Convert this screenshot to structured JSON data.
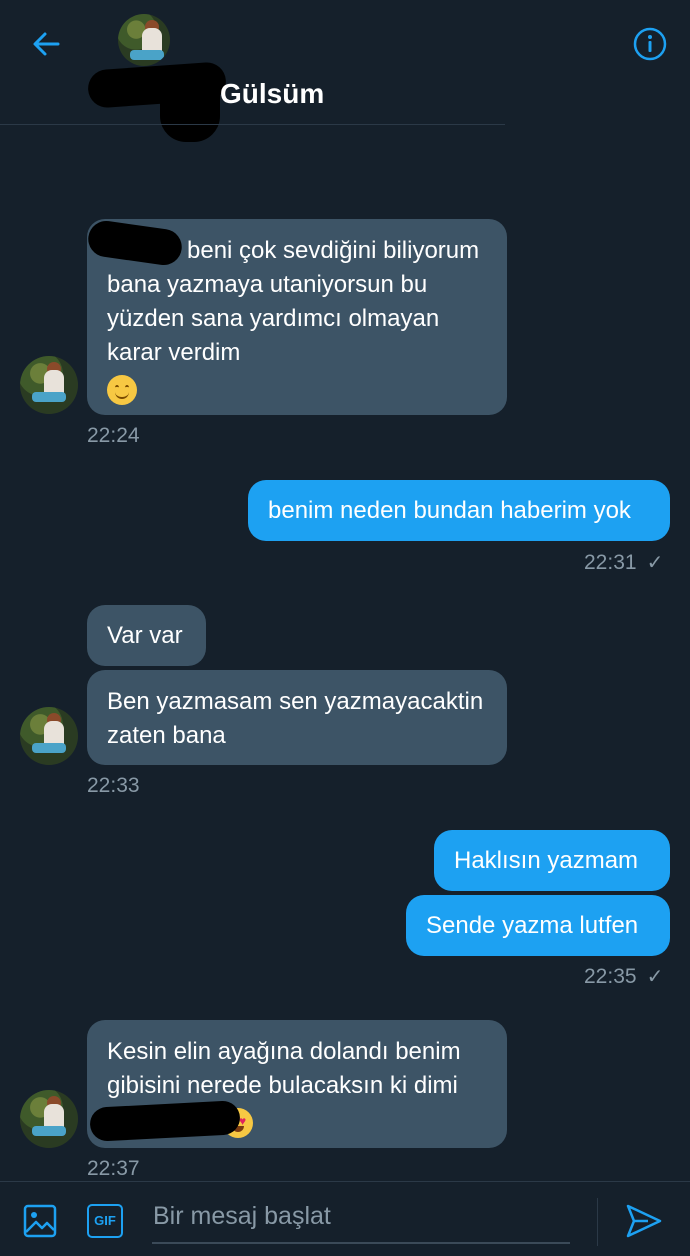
{
  "header": {
    "contact_name": "Gülsüm",
    "back_icon": "arrow-left-icon",
    "info_icon": "info-icon",
    "accent_color": "#1da1f2"
  },
  "messages": {
    "m1": {
      "text": "beni çok sevdiğini biliyorum bana yazmaya utaniyorsun  bu yüzden sana yardımcı olmayan karar verdim",
      "emoji": "smiling-face-emoji",
      "time": "22:24"
    },
    "m2": {
      "text": "benim neden bundan haberim yok",
      "time": "22:31",
      "check": "✓"
    },
    "m3a": {
      "text": "Var var"
    },
    "m3b": {
      "text": "Ben yazmasam sen yazmayacaktin zaten bana",
      "time": "22:33"
    },
    "m4a": {
      "text": "Haklısın yazmam"
    },
    "m4b": {
      "text": "Sende yazma lutfen",
      "time": "22:35",
      "check": "✓"
    },
    "m5": {
      "text": "Kesin elin ayağına dolandı  benim gibisini nerede bulacaksın ki dimi",
      "emoji": "heart-eyes-emoji",
      "time": "22:37"
    }
  },
  "composer": {
    "placeholder": "Bir mesaj başlat",
    "gif_label": "GIF",
    "image_icon": "image-icon",
    "send_icon": "send-icon"
  },
  "colors": {
    "background": "#15202b",
    "incoming_bubble": "#3d5466",
    "outgoing_bubble": "#1da1f2",
    "muted_text": "#8899a6"
  }
}
